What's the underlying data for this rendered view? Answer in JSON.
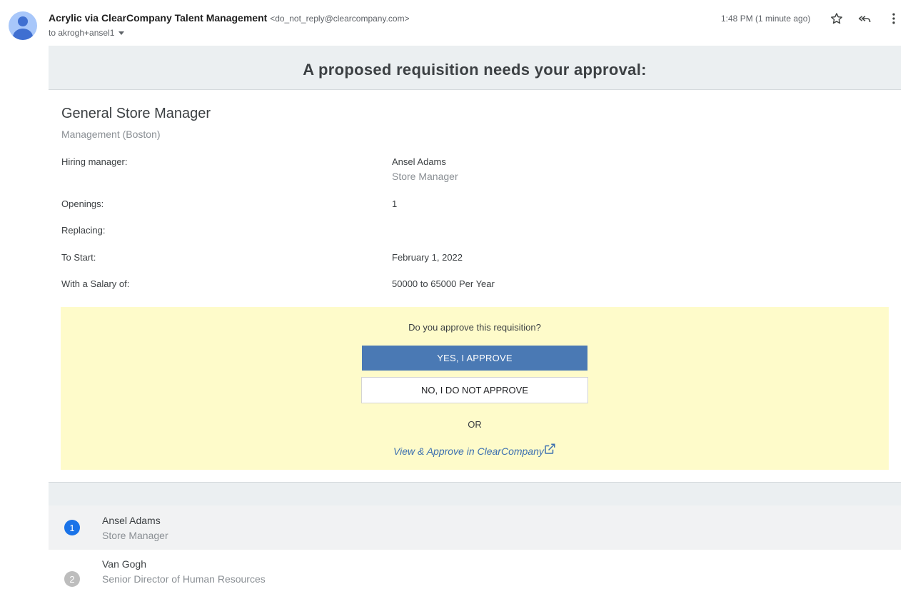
{
  "header": {
    "sender_name": "Acrylic via ClearCompany Talent Management",
    "sender_email": "<do_not_reply@clearcompany.com>",
    "recipient": "to akrogh+ansel1",
    "timestamp": "1:48 PM (1 minute ago)",
    "icons": [
      "star-icon",
      "reply-all-icon",
      "more-vert-icon"
    ]
  },
  "email": {
    "banner_title": "A proposed requisition needs your approval:",
    "position_title": "General Store Manager",
    "department": "Management (Boston)",
    "fields": {
      "hiring_manager_label": "Hiring manager:",
      "hiring_manager_name": "Ansel Adams",
      "hiring_manager_title": "Store Manager",
      "openings_label": "Openings:",
      "openings_value": "1",
      "replacing_label": "Replacing:",
      "replacing_value": "",
      "start_label": "To Start:",
      "start_value": "February 1, 2022",
      "salary_label": "With a Salary of:",
      "salary_value": "50000 to 65000 Per Year"
    },
    "approval": {
      "question": "Do you approve this requisition?",
      "yes_label": "YES, I APPROVE",
      "no_label": "NO, I DO NOT APPROVE",
      "or_label": "OR",
      "link_label": "View & Approve in ClearCompany"
    },
    "approvers": [
      {
        "number": "1",
        "name": "Ansel Adams",
        "role": "Store Manager",
        "color": "#1a73e8"
      },
      {
        "number": "2",
        "name": "Van Gogh",
        "role": "Senior Director of Human Resources",
        "color": "#bdbdbd"
      }
    ]
  },
  "colors": {
    "banner_bg": "#ebeff1",
    "approve_bg": "#fefbca",
    "yes_button": "#4a79b4",
    "link": "#3c6fb0"
  }
}
